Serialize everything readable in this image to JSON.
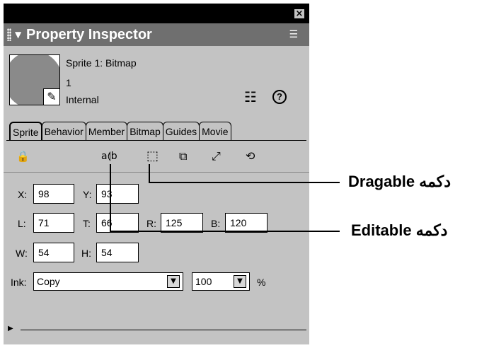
{
  "panel": {
    "close_glyph": "×",
    "title": "Property Inspector",
    "title_arrow": "▼",
    "menu_glyph": "☰"
  },
  "info": {
    "sprite_name": "Sprite 1: Bitmap",
    "number": "1",
    "cast": "Internal",
    "list_glyph": "☷",
    "help_glyph": "?"
  },
  "tabs": [
    "Sprite",
    "Behavior",
    "Member",
    "Bitmap",
    "Guides",
    "Movie"
  ],
  "toolbar": {
    "lock_glyph": "🔒",
    "editable_glyph": "a⟬b",
    "dragable_glyph": "⬚",
    "trails_glyph": "⧉",
    "moveable_glyph": "⤢",
    "flip_glyph": "⟲"
  },
  "fields": {
    "x": {
      "label": "X:",
      "value": "98"
    },
    "y": {
      "label": "Y:",
      "value": "93"
    },
    "l": {
      "label": "L:",
      "value": "71"
    },
    "t": {
      "label": "T:",
      "value": "66"
    },
    "r": {
      "label": "R:",
      "value": "125"
    },
    "b": {
      "label": "B:",
      "value": "120"
    },
    "w": {
      "label": "W:",
      "value": "54"
    },
    "h": {
      "label": "H:",
      "value": "54"
    }
  },
  "ink": {
    "label": "Ink:",
    "value": "Copy",
    "blend": "100",
    "percent": "%",
    "arrow": "▼"
  },
  "bottom_glyph": "▶",
  "callouts": {
    "dragable": "دکمه Dragable",
    "editable": "دکمه Editable"
  }
}
